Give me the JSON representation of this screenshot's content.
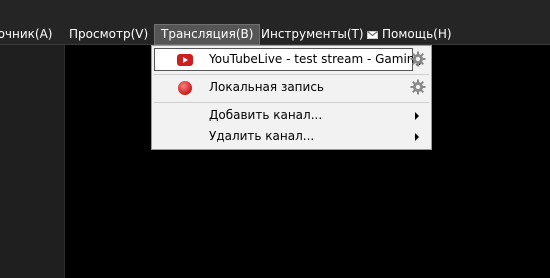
{
  "menubar": {
    "items": [
      {
        "label": "Источник(A)"
      },
      {
        "label": "Просмотр(V)"
      },
      {
        "label": "Трансляция(B)"
      },
      {
        "label": "Инструменты(T)"
      },
      {
        "label": "Помощь(H)"
      }
    ]
  },
  "dropdown": {
    "items": [
      {
        "label": "YouTubeLive - test stream - Gaming",
        "icon": "youtube-icon"
      },
      {
        "label": "Локальная запись",
        "icon": "record-icon"
      },
      {
        "label": "Добавить канал...",
        "icon": "submenu-arrow-icon"
      },
      {
        "label": "Удалить канал...",
        "icon": "submenu-arrow-icon"
      }
    ]
  },
  "colors": {
    "menubar_bg": "#252525",
    "active_menu_bg": "#555555",
    "dropdown_bg": "#f2f2f2",
    "youtube_red": "#cc1f1f",
    "record_red": "#e03030"
  }
}
